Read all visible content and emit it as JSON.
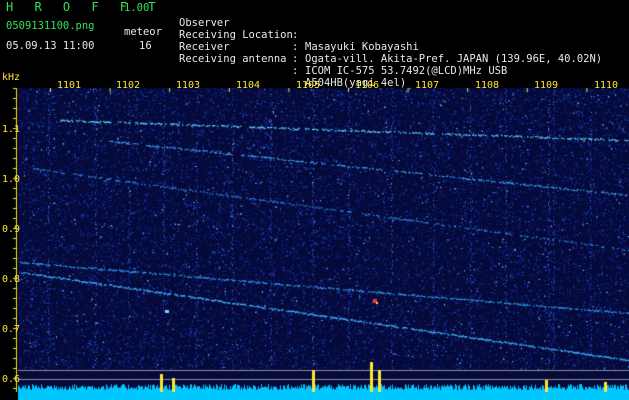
{
  "header": {
    "app_title": "H R O F F T",
    "app_version": "1.00",
    "file_name": "0509131100.png",
    "date_time": "05.09.13 11:00",
    "meteor_label": "meteor",
    "meteor_count": "16"
  },
  "info": [
    {
      "key": "Observer",
      "colon": ":",
      "value": "Masayuki Kobayashi"
    },
    {
      "key": "Receiving Location",
      "colon": ":",
      "value": "Ogata-vill. Akita-Pref. JAPAN (139.96E, 40.02N)"
    },
    {
      "key": "Receiver",
      "colon": ":",
      "value": "ICOM IC-575 53.7492(@LCD)MHz USB"
    },
    {
      "key": "Receiving antenna",
      "colon": ":",
      "value": "A504HB(yagi 4el)"
    }
  ],
  "spectrogram": {
    "unit_label": "kHz",
    "freq_ticks": [
      "1.1",
      "1.0",
      "0.9",
      "0.8",
      "0.7",
      "0.6"
    ],
    "time_ticks": [
      "1101",
      "1102",
      "1103",
      "1104",
      "1105",
      "1106",
      "1107",
      "1108",
      "1109",
      "1110"
    ],
    "colors": {
      "background": "#000000",
      "noise_low": "#0a1a6a",
      "noise_high": "#3f7cff",
      "trace": "#5fd6ff",
      "axis": "#ffe633",
      "echo": "#ff3030"
    }
  }
}
